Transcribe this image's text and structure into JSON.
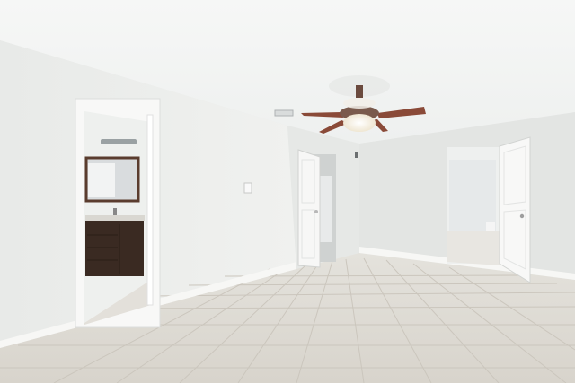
{
  "scene": {
    "description_free": true,
    "colors": {
      "ceiling": "#f3f4f3",
      "wall_left": "#eceeec",
      "wall_back": "#e4e6e4",
      "wall_right": "#e6e8e6",
      "floor_tile": "#ddd9d2",
      "floor_grout": "#c9c4bb",
      "door_white": "#f7f7f6",
      "baseboard": "#f4f4f2",
      "vanity_wood": "#3a2a22",
      "fan_blade": "#8a4a38",
      "fan_light": "#f4eee0"
    }
  }
}
